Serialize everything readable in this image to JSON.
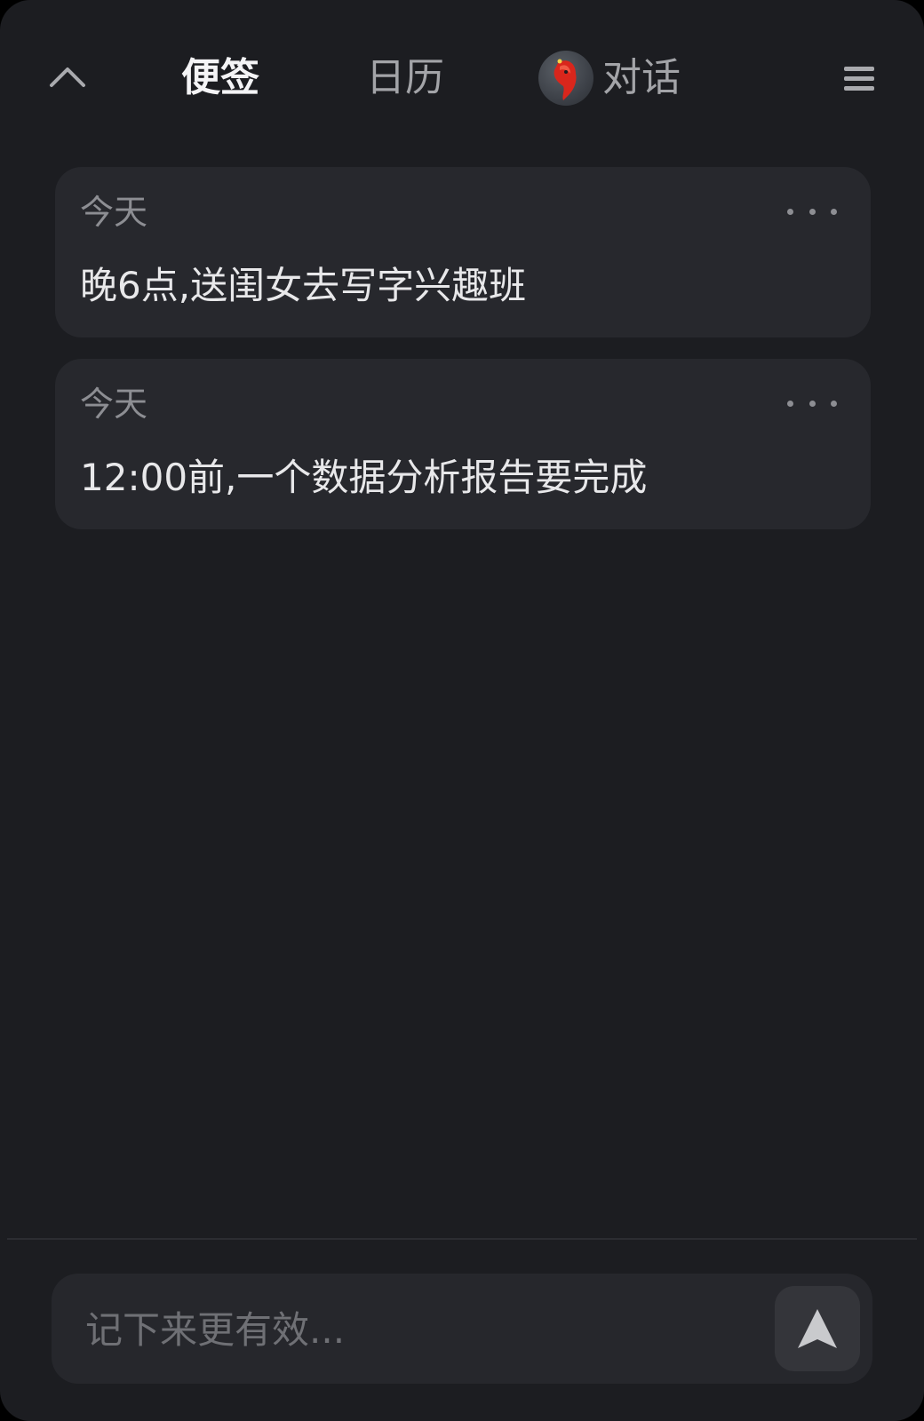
{
  "header": {
    "tabs": [
      {
        "label": "便签",
        "active": true
      },
      {
        "label": "日历",
        "active": false
      },
      {
        "label": "对话",
        "active": false,
        "icon": "assistant-avatar-icon"
      }
    ],
    "collapse_icon": "chevron-up-icon",
    "menu_icon": "hamburger-menu-icon"
  },
  "notes": [
    {
      "date": "今天",
      "text": "晚6点,送闺女去写字兴趣班"
    },
    {
      "date": "今天",
      "text": "12:00前,一个数据分析报告要完成"
    }
  ],
  "composer": {
    "placeholder": "记下来更有效...",
    "value": "",
    "send_icon": "send-arrow-icon"
  },
  "colors": {
    "background": "#1c1d21",
    "card": "#27282d",
    "text_primary": "#e8e8ea",
    "text_secondary": "#8d8e93",
    "avatar_accent": "#d9261c"
  }
}
